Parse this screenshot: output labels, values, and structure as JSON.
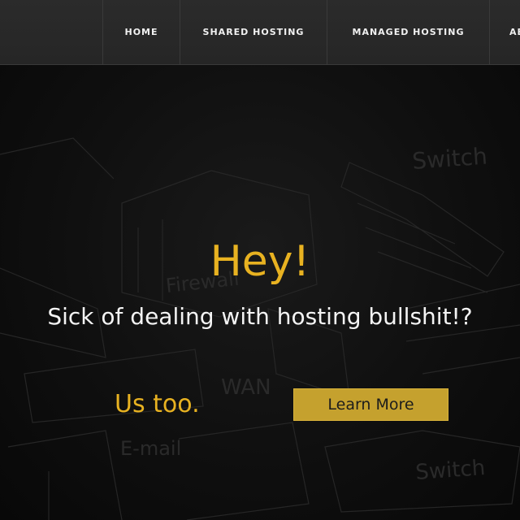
{
  "nav": {
    "items": [
      {
        "label": "HOME"
      },
      {
        "label": "SHARED HOSTING"
      },
      {
        "label": "MANAGED HOSTING"
      },
      {
        "label": "AB"
      }
    ]
  },
  "hero": {
    "title": "Hey!",
    "subtitle": "Sick of dealing with hosting bullshit!?",
    "tagline": "Us too.",
    "cta_label": "Learn More"
  },
  "colors": {
    "accent": "#e8b221",
    "button": "#c5a12e",
    "nav_bg": "#282828",
    "hero_bg": "#0f0f0f"
  }
}
